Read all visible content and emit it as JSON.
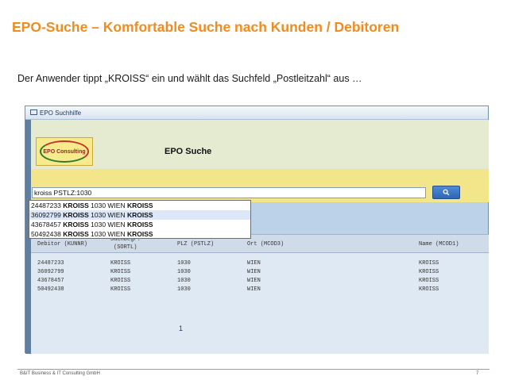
{
  "slide": {
    "title": "EPO-Suche – Komfortable Suche nach Kunden / Debitoren",
    "subtitle": "Der Anwender tippt „KROISS“ ein und wählt das Suchfeld „Postleitzahl“ aus …"
  },
  "window": {
    "title": "EPO Suchhilfe",
    "heading": "EPO Suche",
    "logo_text": "EPO Consulting"
  },
  "search": {
    "value": "kroiss PSTLZ:1030",
    "button_icon": "search-icon"
  },
  "suggestions": [
    {
      "prefix": "24487233 ",
      "bold1": "KROISS",
      "mid": " 1030 WIEN ",
      "bold2": "KROISS"
    },
    {
      "prefix": "36092799 ",
      "bold1": "KROISS",
      "mid": " 1030 WIEN ",
      "bold2": "KROISS"
    },
    {
      "prefix": "43678457 ",
      "bold1": "KROISS",
      "mid": " 1030 WIEN ",
      "bold2": "KROISS"
    },
    {
      "prefix": "50492438 ",
      "bold1": "KROISS",
      "mid": " 1030 WIEN ",
      "bold2": "KROISS"
    }
  ],
  "grid": {
    "headers": {
      "debitor": "Debitor (KUNNR)",
      "suchbegr_1": "Suchbegr.",
      "suchbegr_2": "(SORTL)",
      "plz": "PLZ (PSTLZ)",
      "ort": "Ort (MCOD3)",
      "name": "Name (MCOD1)"
    },
    "rows": [
      {
        "debitor": "24487233",
        "sortl": "KROISS",
        "plz": "1030",
        "ort": "WIEN",
        "name": "KROISS"
      },
      {
        "debitor": "36092799",
        "sortl": "KROISS",
        "plz": "1030",
        "ort": "WIEN",
        "name": "KROISS"
      },
      {
        "debitor": "43678457",
        "sortl": "KROISS",
        "plz": "1030",
        "ort": "WIEN",
        "name": "KROISS"
      },
      {
        "debitor": "50492438",
        "sortl": "KROISS",
        "plz": "1030",
        "ort": "WIEN",
        "name": "KROISS"
      }
    ],
    "page": "1"
  },
  "footer": {
    "company": "B&IT Business & IT Consulting GmbH",
    "page_number": "7"
  },
  "colors": {
    "accent": "#f08c1e",
    "header_panel": "#f3e68a",
    "grid_bg": "#dfe9f3"
  }
}
